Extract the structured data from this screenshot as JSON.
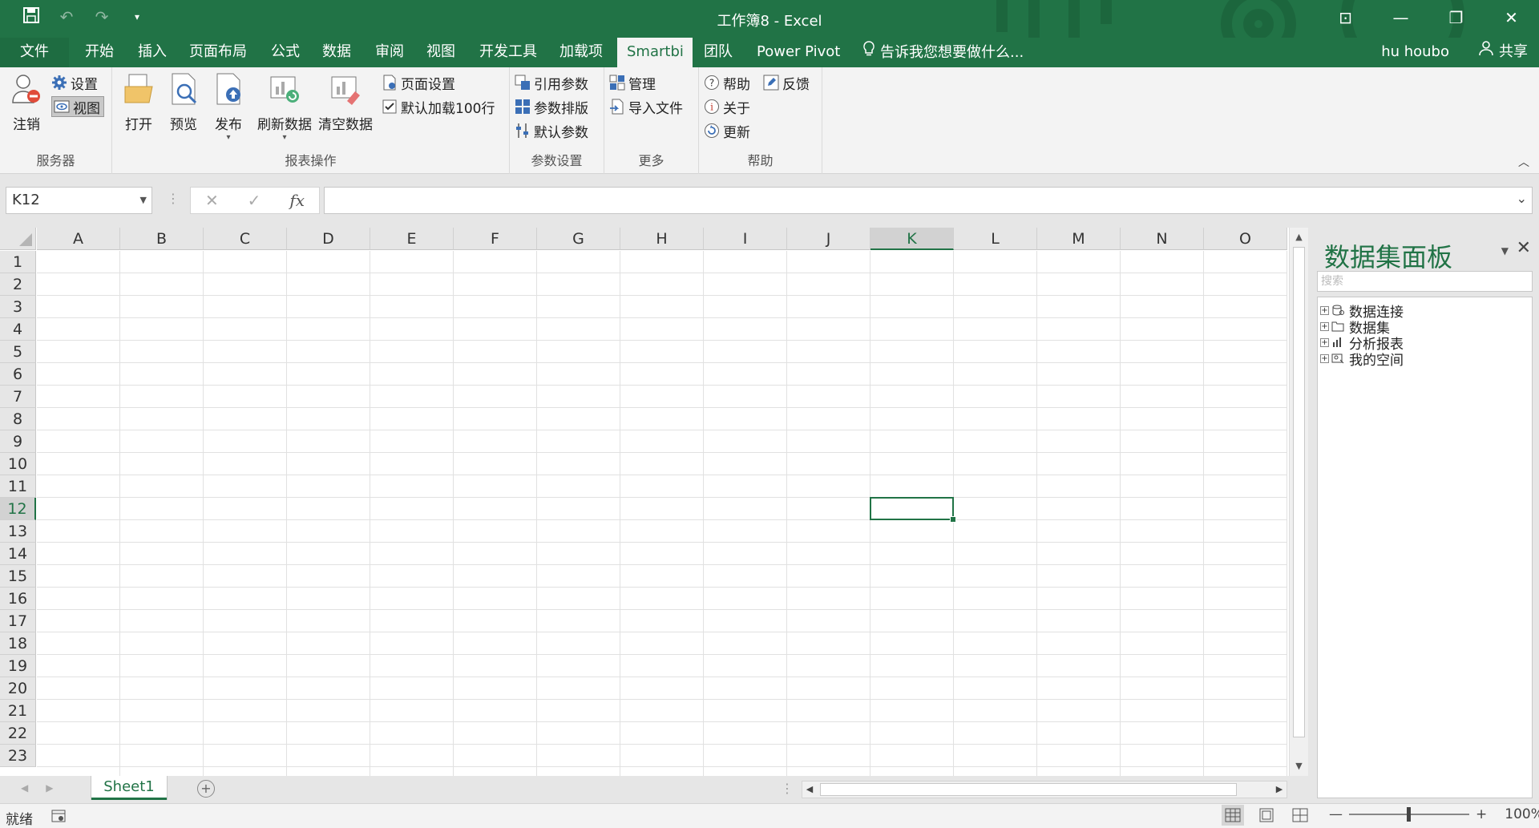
{
  "window": {
    "title": "工作簿8 - Excel",
    "accent_color": "#217346"
  },
  "quick_access": {
    "save_icon": "save-icon",
    "undo_icon": "undo-icon",
    "redo_icon": "redo-icon",
    "customize_icon": "customize-icon"
  },
  "menu_tabs": [
    {
      "label": "文件"
    },
    {
      "label": "开始"
    },
    {
      "label": "插入"
    },
    {
      "label": "页面布局"
    },
    {
      "label": "公式"
    },
    {
      "label": "数据"
    },
    {
      "label": "审阅"
    },
    {
      "label": "视图"
    },
    {
      "label": "开发工具"
    },
    {
      "label": "加载项"
    },
    {
      "label": "Smartbi"
    },
    {
      "label": "团队"
    },
    {
      "label": "Power Pivot"
    }
  ],
  "tell_me": "告诉我您想要做什么...",
  "user": "hu houbo",
  "share": "共享",
  "ribbon": {
    "server": {
      "label": "服务器",
      "logout": "注销",
      "settings": "设置",
      "view": "视图"
    },
    "report_ops": {
      "label": "报表操作",
      "open": "打开",
      "preview": "预览",
      "publish": "发布",
      "refresh": "刷新数据",
      "clear": "清空数据",
      "page_setup": "页面设置",
      "default_load": "默认加载100行"
    },
    "param_settings": {
      "label": "参数设置",
      "ref_params": "引用参数",
      "param_layout": "参数排版",
      "default_params": "默认参数"
    },
    "more": {
      "label": "更多",
      "manage": "管理",
      "import_file": "导入文件"
    },
    "help": {
      "label": "帮助",
      "help": "帮助",
      "feedback": "反馈",
      "about": "关于",
      "update": "更新"
    }
  },
  "formula_bar": {
    "name_box": "K12",
    "formula": ""
  },
  "grid": {
    "columns": [
      "A",
      "B",
      "C",
      "D",
      "E",
      "F",
      "G",
      "H",
      "I",
      "J",
      "K",
      "L",
      "M",
      "N",
      "O"
    ],
    "rows": [
      "1",
      "2",
      "3",
      "4",
      "5",
      "6",
      "7",
      "8",
      "9",
      "10",
      "11",
      "12",
      "13",
      "14",
      "15",
      "16",
      "17",
      "18",
      "19",
      "20",
      "21",
      "22",
      "23"
    ],
    "selected_column": "K",
    "selected_row": "12"
  },
  "sheets": [
    {
      "label": "Sheet1",
      "active": true
    }
  ],
  "panel": {
    "title": "数据集面板",
    "search_placeholder": "搜索",
    "tree": [
      {
        "label": "数据连接",
        "icon": "database-icon"
      },
      {
        "label": "数据集",
        "icon": "folder-icon"
      },
      {
        "label": "分析报表",
        "icon": "chart-icon"
      },
      {
        "label": "我的空间",
        "icon": "user-space-icon"
      }
    ]
  },
  "status": {
    "ready": "就绪",
    "zoom": "100%"
  }
}
